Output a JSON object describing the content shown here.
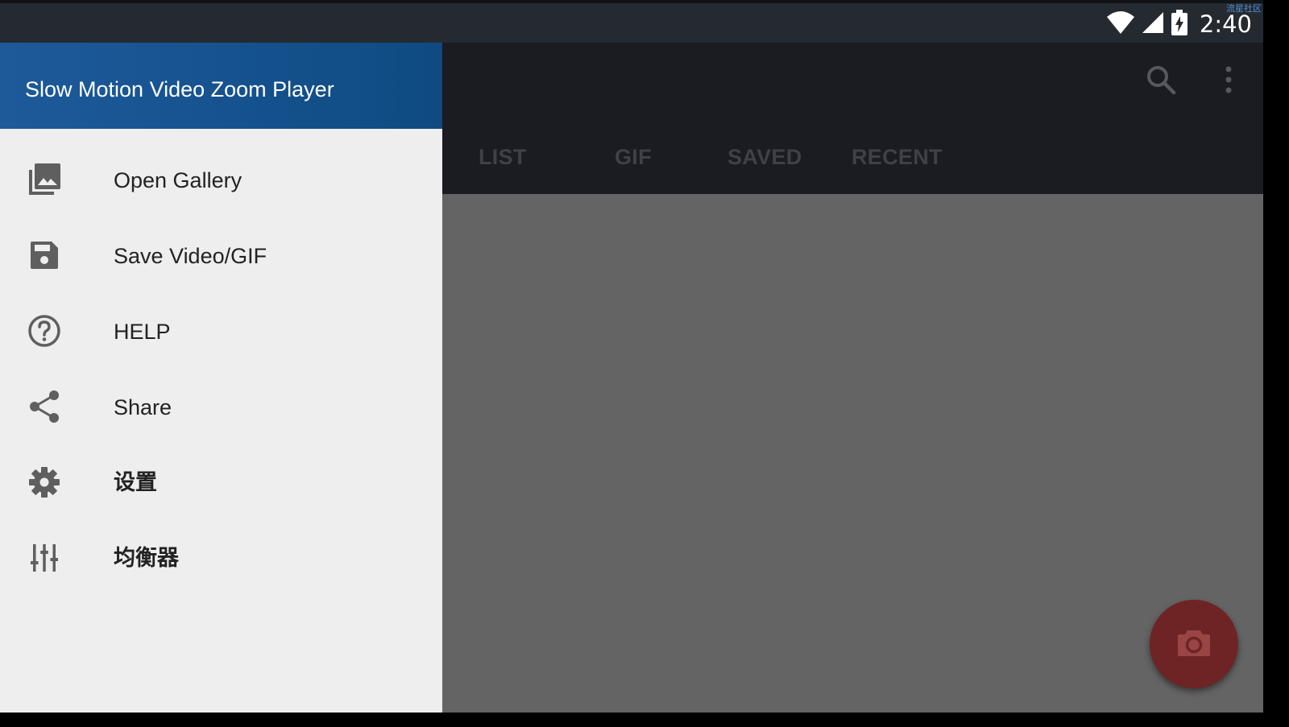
{
  "status_bar": {
    "time": "2:40",
    "watermark": "流星社区",
    "icons": [
      "wifi-icon",
      "cell-signal-icon",
      "battery-charging-icon"
    ]
  },
  "app_bar": {
    "icons": [
      "search-icon",
      "more-vert-icon"
    ],
    "tabs": [
      {
        "label": "LIST"
      },
      {
        "label": "GIF"
      },
      {
        "label": "SAVED"
      },
      {
        "label": "RECENT"
      }
    ]
  },
  "drawer": {
    "title": "Slow Motion Video Zoom Player",
    "items": [
      {
        "label": "Open Gallery",
        "icon": "gallery-icon"
      },
      {
        "label": "Save Video/GIF",
        "icon": "save-icon"
      },
      {
        "label": "HELP",
        "icon": "help-icon"
      },
      {
        "label": "Share",
        "icon": "share-icon"
      },
      {
        "label": "设置",
        "icon": "settings-icon"
      },
      {
        "label": "均衡器",
        "icon": "equalizer-icon"
      }
    ]
  },
  "fab": {
    "icon": "camera-icon"
  },
  "colors": {
    "status_bar": "#252a31",
    "app_bar_dimmed": "#1a1c21",
    "drawer_header": "#14518c",
    "drawer_bg": "#eeeeee",
    "scrim_content": "#646464",
    "fab_dimmed": "#6e2424",
    "menu_icon": "#5f5f5f"
  }
}
